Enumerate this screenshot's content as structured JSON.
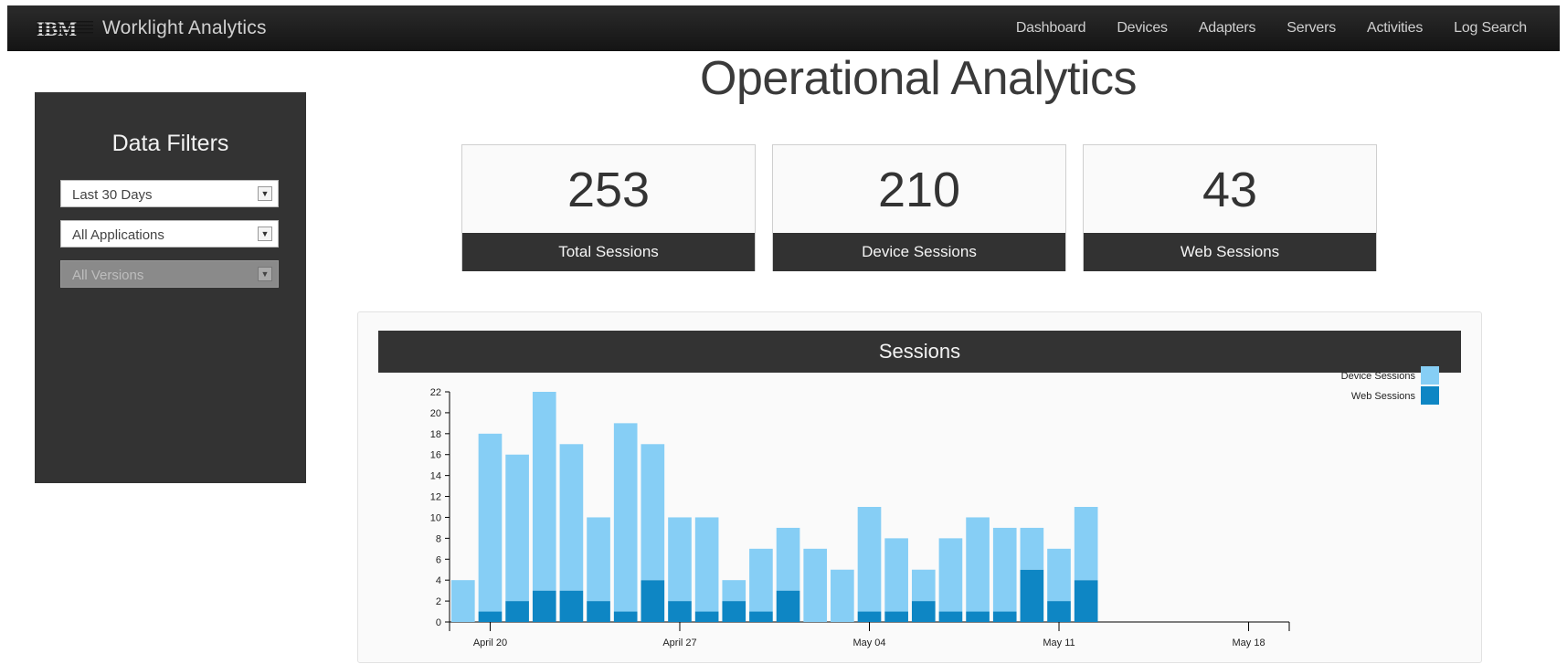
{
  "app": {
    "title": "Worklight Analytics",
    "logo_text": "IBM"
  },
  "nav": {
    "items": [
      "Dashboard",
      "Devices",
      "Adapters",
      "Servers",
      "Activities",
      "Log Search"
    ]
  },
  "page": {
    "title": "Operational Analytics"
  },
  "filters": {
    "title": "Data Filters",
    "date_range": "Last 30 Days",
    "application": "All Applications",
    "version": "All Versions"
  },
  "kpis": [
    {
      "value": "253",
      "label": "Total Sessions"
    },
    {
      "value": "210",
      "label": "Device Sessions"
    },
    {
      "value": "43",
      "label": "Web Sessions"
    }
  ],
  "chart_data": {
    "type": "bar",
    "stacked": true,
    "title": "Sessions",
    "xlabel": "",
    "ylabel": "",
    "ylim": [
      0,
      22
    ],
    "yticks": [
      0,
      2,
      4,
      6,
      8,
      10,
      12,
      14,
      16,
      18,
      20,
      22
    ],
    "x_tick_labels": [
      "April 20",
      "April 27",
      "May 04",
      "May 11",
      "May 18"
    ],
    "x_domain": [
      "April 19",
      "May 20"
    ],
    "categories": [
      "April 19",
      "April 20",
      "April 21",
      "April 22",
      "April 23",
      "April 24",
      "April 25",
      "April 26",
      "April 27",
      "April 28",
      "April 29",
      "April 30",
      "May 01",
      "May 02",
      "May 03",
      "May 04",
      "May 05",
      "May 06",
      "May 07",
      "May 08",
      "May 09",
      "May 10",
      "May 11",
      "May 12"
    ],
    "series": [
      {
        "name": "Web Sessions",
        "color": "#0e86c4",
        "values": [
          0,
          1,
          2,
          3,
          3,
          2,
          1,
          4,
          2,
          1,
          2,
          1,
          3,
          0,
          0,
          1,
          1,
          2,
          1,
          1,
          1,
          5,
          2,
          4
        ]
      },
      {
        "name": "Device Sessions",
        "color": "#86cef5",
        "values": [
          4,
          17,
          14,
          19,
          14,
          8,
          18,
          13,
          8,
          9,
          2,
          6,
          6,
          7,
          5,
          10,
          7,
          3,
          7,
          9,
          8,
          4,
          5,
          7
        ]
      }
    ],
    "legend": {
      "position": "top-right"
    },
    "grid": false
  }
}
